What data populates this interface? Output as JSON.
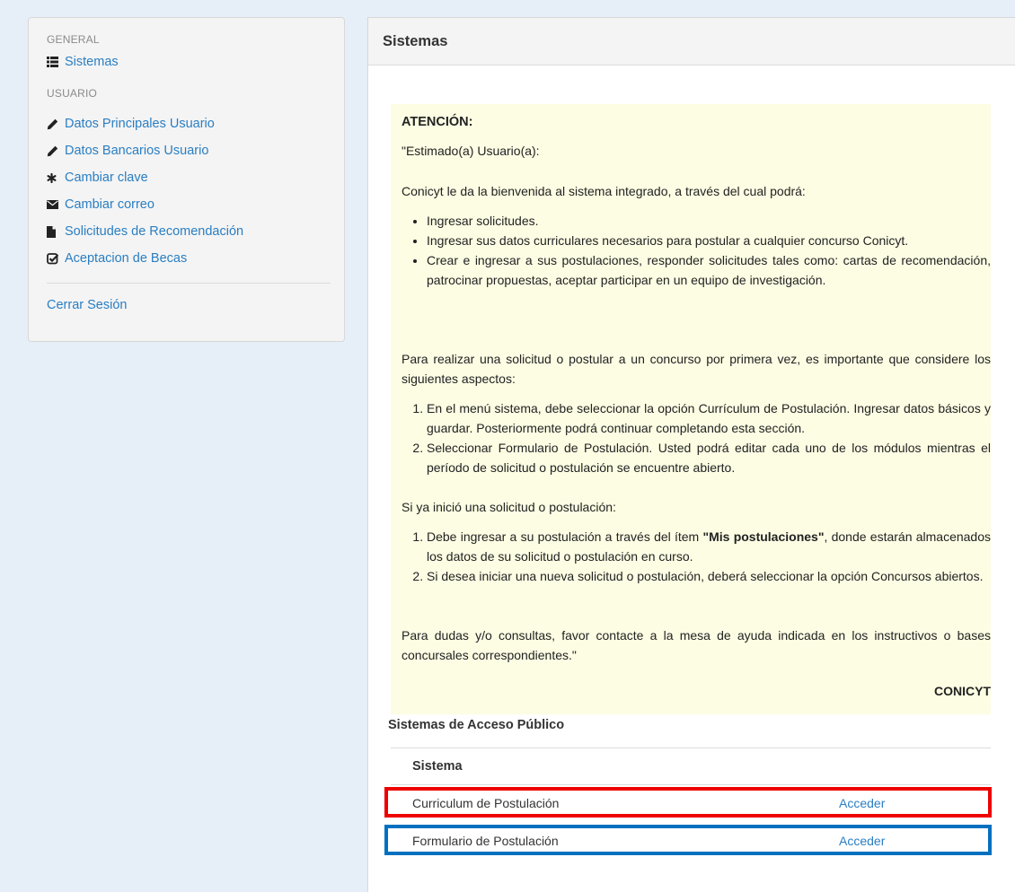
{
  "sidebar": {
    "general_header": "GENERAL",
    "sistemas": {
      "label": "Sistemas",
      "icon": "list-icon"
    },
    "usuario_header": "USUARIO",
    "items": [
      {
        "label": "Datos Principales Usuario",
        "icon": "pencil-icon"
      },
      {
        "label": "Datos Bancarios Usuario",
        "icon": "pencil-icon"
      },
      {
        "label": "Cambiar clave",
        "icon": "asterisk-icon"
      },
      {
        "label": "Cambiar correo",
        "icon": "envelope-icon"
      },
      {
        "label": "Solicitudes de Recomendación",
        "icon": "file-icon"
      },
      {
        "label": "Aceptacion de Becas",
        "icon": "check-square-icon"
      }
    ],
    "logout": "Cerrar Sesión"
  },
  "panel": {
    "title": "Sistemas"
  },
  "notice": {
    "title": "ATENCIÓN:",
    "greeting": "\"Estimado(a) Usuario(a):",
    "intro": "Conicyt le da la bienvenida al sistema integrado, a través del cual podrá:",
    "bullets": [
      "Ingresar solicitudes.",
      "Ingresar sus datos curriculares necesarios para postular a cualquier concurso Conicyt.",
      "Crear e ingresar a sus postulaciones, responder solicitudes tales como: cartas de recomendación, patrocinar propuestas, aceptar participar en un equipo de investigación."
    ],
    "first_time": "Para realizar una solicitud o postular a un concurso por primera vez, es importante que considere los siguientes aspectos:",
    "steps": [
      "En el menú sistema, debe seleccionar la opción Currículum de Postulación. Ingresar datos básicos y guardar. Posteriormente podrá continuar completando esta sección.",
      "Seleccionar Formulario de Postulación. Usted podrá editar cada uno de los módulos mientras el período de solicitud o postulación se encuentre abierto."
    ],
    "started": "Si ya inició una solicitud o postulación:",
    "started_steps": {
      "first_pre": "Debe ingresar a su postulación a través del ítem ",
      "first_bold": "\"Mis postulaciones\"",
      "first_post": ", donde estarán almacenados los datos de su solicitud o postulación en curso.",
      "second": "Si desea iniciar una nueva solicitud o postulación, deberá seleccionar la opción Concursos abiertos."
    },
    "help": "Para dudas y/o consultas, favor contacte a la mesa de ayuda indicada en los instructivos o bases concursales correspondientes.\"",
    "signature": "CONICYT"
  },
  "public_systems": {
    "title": "Sistemas de Acceso Público",
    "column_header": "Sistema",
    "rows": [
      {
        "name": "Curriculum de Postulación",
        "action": "Acceder",
        "highlight": "#ee0000"
      },
      {
        "name": "Formulario de Postulación",
        "action": "Acceder",
        "highlight": "#0070c0"
      }
    ]
  }
}
